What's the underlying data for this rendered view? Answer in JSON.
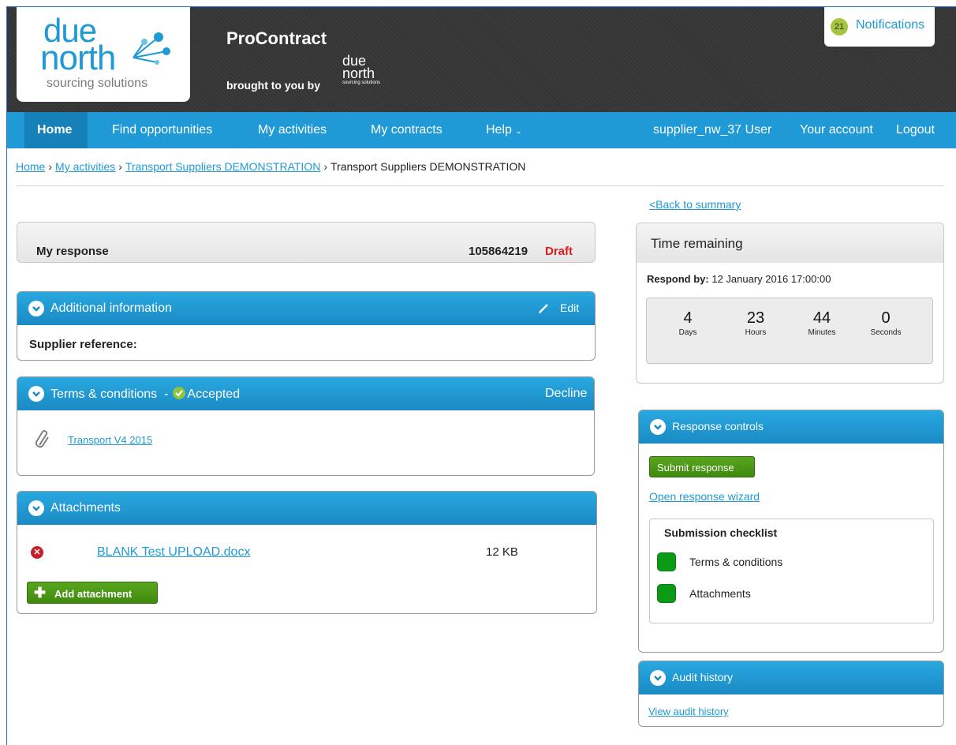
{
  "header": {
    "logo": {
      "line1": "due",
      "line2": "north",
      "sub": "sourcing solutions"
    },
    "app_title": "ProContract",
    "brought_by": "brought to you by",
    "mini_logo": {
      "line1": "due",
      "line2": "north",
      "sub": "sourcing solutions"
    },
    "notifications": {
      "count": "21",
      "label": "Notifications"
    }
  },
  "nav": {
    "home": "Home",
    "find": "Find opportunities",
    "activities": "My activities",
    "contracts": "My contracts",
    "help": "Help",
    "user": "supplier_nw_37 User",
    "account": "Your account",
    "logout": "Logout"
  },
  "breadcrumb": {
    "home": "Home",
    "activities": "My activities",
    "parent": "Transport Suppliers DEMONSTRATION",
    "current": "Transport Suppliers DEMONSTRATION"
  },
  "back_link": "<Back to summary",
  "my_response": {
    "label": "My response",
    "number": "105864219",
    "status": "Draft",
    "status_color": "#e21a1a"
  },
  "additional_info": {
    "title": "Additional information",
    "edit": "Edit",
    "supplier_ref_label": "Supplier reference:"
  },
  "terms": {
    "title": "Terms & conditions",
    "dash": "-",
    "status": "Accepted",
    "decline": "Decline",
    "file": "Transport V4 2015"
  },
  "attachments": {
    "title": "Attachments",
    "file": "BLANK Test UPLOAD.docx",
    "size": "12 KB",
    "add_button": "Add attachment"
  },
  "time_remaining": {
    "title": "Time remaining",
    "respond_by_label": "Respond by:",
    "respond_by_value": "12 January 2016 17:00:00",
    "days": "4",
    "days_label": "Days",
    "hours": "23",
    "hours_label": "Hours",
    "minutes": "44",
    "minutes_label": "Minutes",
    "seconds": "0",
    "seconds_label": "Seconds"
  },
  "response_controls": {
    "title": "Response controls",
    "submit": "Submit response",
    "wizard": "Open response wizard",
    "checklist_title": "Submission checklist",
    "checklist": [
      "Terms & conditions",
      "Attachments"
    ]
  },
  "audit": {
    "title": "Audit history",
    "link": "View audit history"
  },
  "colors": {
    "accent": "#1f9ad6",
    "header_dark": "#3a3a3a",
    "green": "#3f8a0f",
    "draft_red": "#e21a1a"
  }
}
